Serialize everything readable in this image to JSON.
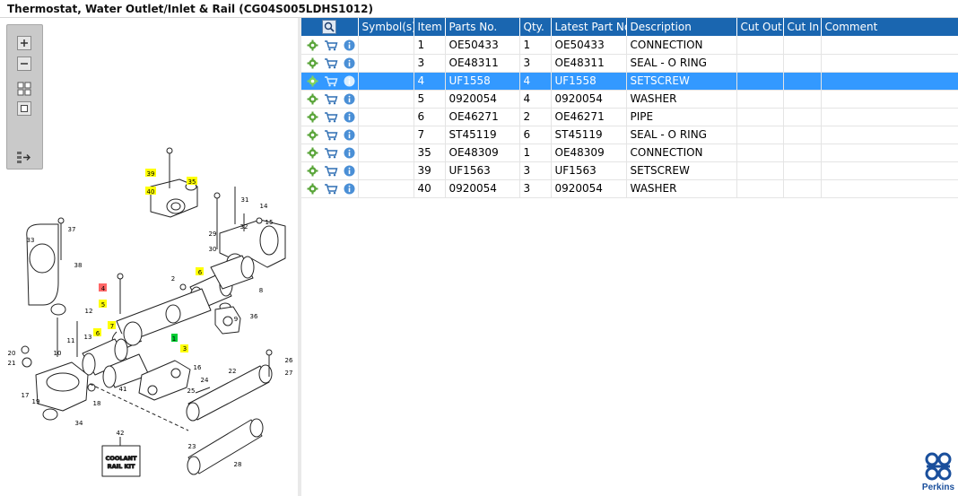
{
  "title": "Thermostat, Water Outlet/Inlet & Rail (CG04S005LDHS1012)",
  "toolbar": {
    "zoom_in": "zoom-in-icon",
    "zoom_out": "zoom-out-icon",
    "fit": "fit-icon",
    "actual_size": "actual-size-icon",
    "expand": "expand-panel-icon"
  },
  "diagram": {
    "callouts": [
      "39",
      "40",
      "35",
      "31",
      "14",
      "15",
      "32",
      "29",
      "30",
      "37",
      "33",
      "38",
      "6",
      "2",
      "8",
      "4",
      "5",
      "9",
      "36",
      "12",
      "7",
      "6",
      "11",
      "13",
      "1",
      "3",
      "16",
      "20",
      "21",
      "10",
      "26",
      "27",
      "22",
      "25",
      "24",
      "17",
      "41",
      "19",
      "18",
      "34",
      "23",
      "42",
      "28"
    ],
    "kit_label_1": "COOLANT",
    "kit_label_2": "RAIL KIT"
  },
  "table": {
    "columns": [
      "Symbol(s)",
      "Item",
      "Parts No.",
      "Qty.",
      "Latest Part No.",
      "Description",
      "Cut Out",
      "Cut In",
      "Comment"
    ],
    "rows": [
      {
        "item": "1",
        "part_no": "OE50433",
        "qty": "1",
        "latest": "OE50433",
        "desc": "CONNECTION",
        "cut_out": "",
        "cut_in": "",
        "comment": ""
      },
      {
        "item": "3",
        "part_no": "OE48311",
        "qty": "3",
        "latest": "OE48311",
        "desc": "SEAL - O RING",
        "cut_out": "",
        "cut_in": "",
        "comment": ""
      },
      {
        "item": "4",
        "part_no": "UF1558",
        "qty": "4",
        "latest": "UF1558",
        "desc": "SETSCREW",
        "cut_out": "",
        "cut_in": "",
        "comment": ""
      },
      {
        "item": "5",
        "part_no": "0920054",
        "qty": "4",
        "latest": "0920054",
        "desc": "WASHER",
        "cut_out": "",
        "cut_in": "",
        "comment": ""
      },
      {
        "item": "6",
        "part_no": "OE46271",
        "qty": "2",
        "latest": "OE46271",
        "desc": "PIPE",
        "cut_out": "",
        "cut_in": "",
        "comment": ""
      },
      {
        "item": "7",
        "part_no": "ST45119",
        "qty": "6",
        "latest": "ST45119",
        "desc": "SEAL - O RING",
        "cut_out": "",
        "cut_in": "",
        "comment": ""
      },
      {
        "item": "35",
        "part_no": "OE48309",
        "qty": "1",
        "latest": "OE48309",
        "desc": "CONNECTION",
        "cut_out": "",
        "cut_in": "",
        "comment": ""
      },
      {
        "item": "39",
        "part_no": "UF1563",
        "qty": "3",
        "latest": "UF1563",
        "desc": "SETSCREW",
        "cut_out": "",
        "cut_in": "",
        "comment": ""
      },
      {
        "item": "40",
        "part_no": "0920054",
        "qty": "3",
        "latest": "0920054",
        "desc": "WASHER",
        "cut_out": "",
        "cut_in": "",
        "comment": ""
      }
    ],
    "selected_index": 2
  },
  "logo": {
    "text": "Perkins",
    "color": "#1a4f9c"
  },
  "colors": {
    "header": "#1a66b0",
    "selected": "#3399ff",
    "highlight_yellow": "#ffff00",
    "highlight_red": "#ff6666",
    "highlight_green": "#00cc33"
  }
}
